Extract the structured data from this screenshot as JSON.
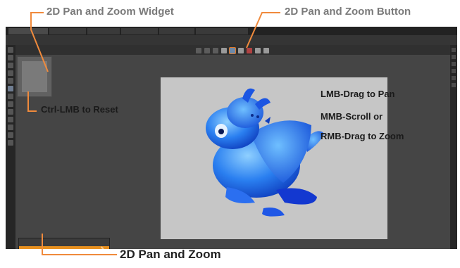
{
  "callouts": {
    "widget": "2D Pan and Zoom Widget",
    "button": "2D Pan and Zoom Button",
    "reset": "Ctrl-LMB to Reset",
    "mode": "2D Pan and Zoom"
  },
  "instructions": {
    "pan": "LMB-Drag to Pan",
    "zoom_line1": "MMB-Scroll or",
    "zoom_line2": "RMB-Drag to Zoom"
  },
  "colors": {
    "callout_line": "#f08a3c",
    "dragon_blue": "#1f66e8",
    "menu_highlight": "#e8901f",
    "canvas_bg": "#c6c6c6"
  },
  "icons": {
    "pan_zoom_button": "pan-zoom-icon",
    "menu_pin": "pin-icon"
  }
}
